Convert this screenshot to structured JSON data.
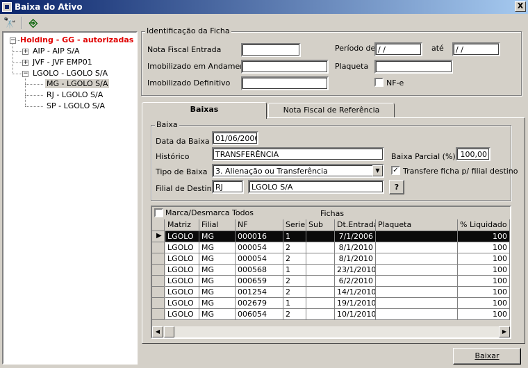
{
  "window": {
    "title": "Baixa do Ativo",
    "close_label": "X"
  },
  "toolbar": {
    "search_glyph": "🔭",
    "exit_glyph": "⎆"
  },
  "tree": {
    "root": "Holding -  GG -  autorizadas",
    "nodes": [
      {
        "label": "AIP - AIP S/A",
        "expander": "+"
      },
      {
        "label": "JVF - JVF  EMP01",
        "expander": "+"
      },
      {
        "label": "LGOLO - LGOLO S/A",
        "expander": "−"
      }
    ],
    "children": [
      {
        "label": "MG - LGOLO S/A",
        "selected": true
      },
      {
        "label": "RJ - LGOLO S/A",
        "selected": false
      },
      {
        "label": "SP - LGOLO S/A",
        "selected": false
      }
    ],
    "root_expander": "−"
  },
  "ident": {
    "legend": "Identificação da Ficha",
    "nf_entrada_label": "Nota Fiscal Entrada",
    "nf_entrada_value": "",
    "andamento_label": "Imobilizado em Andamento",
    "andamento_value": "",
    "definitivo_label": "Imobilizado Definitivo",
    "definitivo_value": "",
    "periodo_label": "Período de",
    "periodo_de_value": " / /",
    "ate_label": "até",
    "periodo_ate_value": " / /",
    "plaqueta_label": "Plaqueta",
    "plaqueta_value": "",
    "nfe_label": "NF-e"
  },
  "tabs": [
    {
      "label": "Baixas",
      "active": true
    },
    {
      "label": "Nota Fiscal de Referência",
      "active": false
    }
  ],
  "baixa": {
    "legend": "Baixa",
    "data_label": "Data da Baixa",
    "data_value": "01/06/2006",
    "historico_label": "Histórico",
    "historico_value": "TRANSFERÊNCIA",
    "parcial_label": "Baixa Parcial (%)",
    "parcial_value": "100,00",
    "tipo_label": "Tipo de Baixa",
    "tipo_value": "3. Alienação ou Transferência",
    "transfere_label": "Transfere ficha p/ filial destino",
    "transfere_checked": "✓",
    "filial_label": "Filial de Destino",
    "filial_code": "RJ",
    "filial_name": "LGOLO S/A",
    "help_label": "?"
  },
  "grid": {
    "marca_label": "Marca/Desmarca Todos",
    "title": "Fichas",
    "columns": [
      "Matriz",
      "Filial",
      "NF",
      "Serie",
      "Sub",
      "Dt.Entrada",
      "Plaqueta",
      "% Liquidado"
    ],
    "rows": [
      [
        "LGOLO",
        "MG",
        "000016",
        "1",
        "",
        "7/1/2006",
        "",
        "100"
      ],
      [
        "LGOLO",
        "MG",
        "000054",
        "2",
        "",
        "8/1/2010",
        "",
        "100"
      ],
      [
        "LGOLO",
        "MG",
        "000054",
        "2",
        "",
        "8/1/2010",
        "",
        "100"
      ],
      [
        "LGOLO",
        "MG",
        "000568",
        "1",
        "",
        "23/1/2010",
        "",
        "100"
      ],
      [
        "LGOLO",
        "MG",
        "000659",
        "2",
        "",
        "6/2/2010",
        "",
        "100"
      ],
      [
        "LGOLO",
        "MG",
        "001254",
        "2",
        "",
        "14/1/2010",
        "",
        "100"
      ],
      [
        "LGOLO",
        "MG",
        "002679",
        "1",
        "",
        "19/1/2010",
        "",
        "100"
      ],
      [
        "LGOLO",
        "MG",
        "006054",
        "2",
        "",
        "10/1/2010",
        "",
        "100"
      ]
    ],
    "selected_row": 0
  },
  "footer": {
    "baixar_label": "Baixar"
  }
}
